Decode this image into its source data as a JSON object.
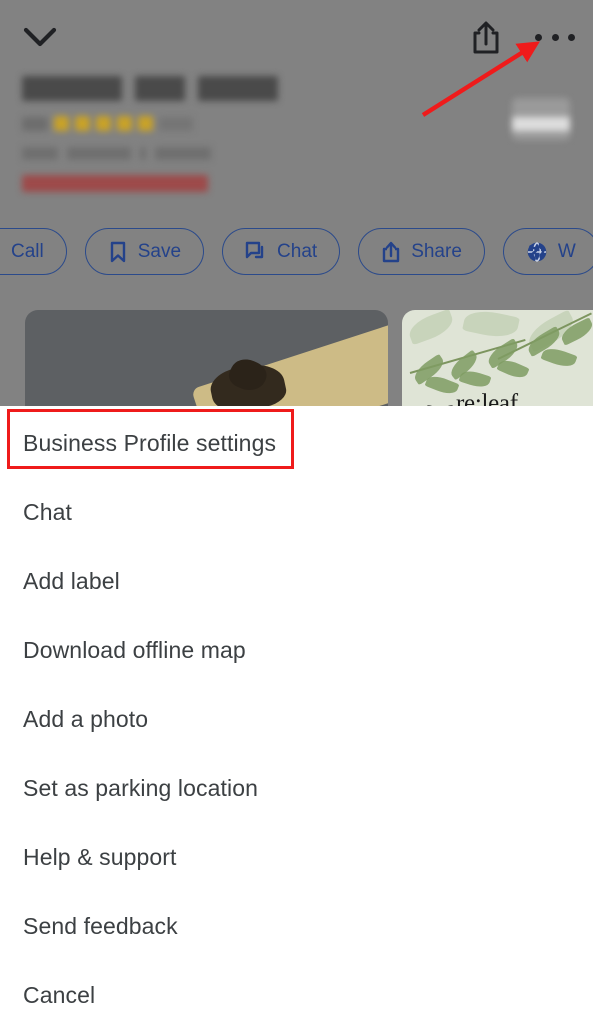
{
  "backdrop": {
    "topbar": {
      "collapse_icon": "chevron-down-icon",
      "share_icon": "share-icon",
      "overflow_icon": "more-options-icon"
    },
    "business": {
      "name_redacted": "",
      "rating_redacted": "",
      "category_redacted": "",
      "status_redacted": "",
      "status_color": "#9d4a4a",
      "star_color": "#c9a227"
    },
    "action_chips": [
      {
        "label": "Call",
        "icon": "phone-icon"
      },
      {
        "label": "Save",
        "icon": "bookmark-icon"
      },
      {
        "label": "Chat",
        "icon": "chat-bubble-icon"
      },
      {
        "label": "Share",
        "icon": "share-icon"
      },
      {
        "label": "W",
        "icon": "globe-icon"
      }
    ],
    "chip_color": "#24428a",
    "photos": [
      {
        "name": "tea-scoop-photo",
        "caption": ""
      },
      {
        "name": "releaf-branding-photo",
        "caption": "re:leaf"
      }
    ],
    "scrim_color": "#828282"
  },
  "annotation": {
    "arrow_color": "#ef1b1b",
    "highlight_color": "#ef1b1b"
  },
  "menu": {
    "items": [
      {
        "label": "Business Profile settings"
      },
      {
        "label": "Chat"
      },
      {
        "label": "Add label"
      },
      {
        "label": "Download offline map"
      },
      {
        "label": "Add a photo"
      },
      {
        "label": "Set as parking location"
      },
      {
        "label": "Help & support"
      },
      {
        "label": "Send feedback"
      },
      {
        "label": "Cancel"
      }
    ]
  }
}
